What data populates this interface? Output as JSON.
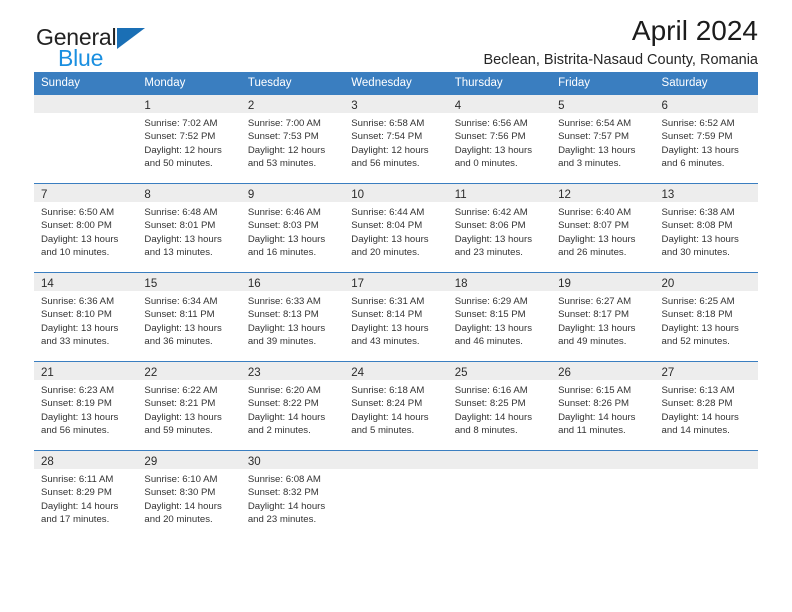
{
  "brand": {
    "name_part1": "General",
    "name_part2": "Blue",
    "triangle_color": "#1a6fb5",
    "blue_text_color": "#1a8fe0"
  },
  "header": {
    "title": "April 2024",
    "subtitle": "Beclean, Bistrita-Nasaud County, Romania"
  },
  "theme": {
    "header_blue": "#3a7ec0",
    "daynum_band": "#ededed",
    "text": "#333333"
  },
  "weekdays": [
    "Sunday",
    "Monday",
    "Tuesday",
    "Wednesday",
    "Thursday",
    "Friday",
    "Saturday"
  ],
  "weeks": [
    [
      {
        "day": ""
      },
      {
        "day": "1",
        "sunrise": "Sunrise: 7:02 AM",
        "sunset": "Sunset: 7:52 PM",
        "daylight_line1": "Daylight: 12 hours",
        "daylight_line2": "and 50 minutes."
      },
      {
        "day": "2",
        "sunrise": "Sunrise: 7:00 AM",
        "sunset": "Sunset: 7:53 PM",
        "daylight_line1": "Daylight: 12 hours",
        "daylight_line2": "and 53 minutes."
      },
      {
        "day": "3",
        "sunrise": "Sunrise: 6:58 AM",
        "sunset": "Sunset: 7:54 PM",
        "daylight_line1": "Daylight: 12 hours",
        "daylight_line2": "and 56 minutes."
      },
      {
        "day": "4",
        "sunrise": "Sunrise: 6:56 AM",
        "sunset": "Sunset: 7:56 PM",
        "daylight_line1": "Daylight: 13 hours",
        "daylight_line2": "and 0 minutes."
      },
      {
        "day": "5",
        "sunrise": "Sunrise: 6:54 AM",
        "sunset": "Sunset: 7:57 PM",
        "daylight_line1": "Daylight: 13 hours",
        "daylight_line2": "and 3 minutes."
      },
      {
        "day": "6",
        "sunrise": "Sunrise: 6:52 AM",
        "sunset": "Sunset: 7:59 PM",
        "daylight_line1": "Daylight: 13 hours",
        "daylight_line2": "and 6 minutes."
      }
    ],
    [
      {
        "day": "7",
        "sunrise": "Sunrise: 6:50 AM",
        "sunset": "Sunset: 8:00 PM",
        "daylight_line1": "Daylight: 13 hours",
        "daylight_line2": "and 10 minutes."
      },
      {
        "day": "8",
        "sunrise": "Sunrise: 6:48 AM",
        "sunset": "Sunset: 8:01 PM",
        "daylight_line1": "Daylight: 13 hours",
        "daylight_line2": "and 13 minutes."
      },
      {
        "day": "9",
        "sunrise": "Sunrise: 6:46 AM",
        "sunset": "Sunset: 8:03 PM",
        "daylight_line1": "Daylight: 13 hours",
        "daylight_line2": "and 16 minutes."
      },
      {
        "day": "10",
        "sunrise": "Sunrise: 6:44 AM",
        "sunset": "Sunset: 8:04 PM",
        "daylight_line1": "Daylight: 13 hours",
        "daylight_line2": "and 20 minutes."
      },
      {
        "day": "11",
        "sunrise": "Sunrise: 6:42 AM",
        "sunset": "Sunset: 8:06 PM",
        "daylight_line1": "Daylight: 13 hours",
        "daylight_line2": "and 23 minutes."
      },
      {
        "day": "12",
        "sunrise": "Sunrise: 6:40 AM",
        "sunset": "Sunset: 8:07 PM",
        "daylight_line1": "Daylight: 13 hours",
        "daylight_line2": "and 26 minutes."
      },
      {
        "day": "13",
        "sunrise": "Sunrise: 6:38 AM",
        "sunset": "Sunset: 8:08 PM",
        "daylight_line1": "Daylight: 13 hours",
        "daylight_line2": "and 30 minutes."
      }
    ],
    [
      {
        "day": "14",
        "sunrise": "Sunrise: 6:36 AM",
        "sunset": "Sunset: 8:10 PM",
        "daylight_line1": "Daylight: 13 hours",
        "daylight_line2": "and 33 minutes."
      },
      {
        "day": "15",
        "sunrise": "Sunrise: 6:34 AM",
        "sunset": "Sunset: 8:11 PM",
        "daylight_line1": "Daylight: 13 hours",
        "daylight_line2": "and 36 minutes."
      },
      {
        "day": "16",
        "sunrise": "Sunrise: 6:33 AM",
        "sunset": "Sunset: 8:13 PM",
        "daylight_line1": "Daylight: 13 hours",
        "daylight_line2": "and 39 minutes."
      },
      {
        "day": "17",
        "sunrise": "Sunrise: 6:31 AM",
        "sunset": "Sunset: 8:14 PM",
        "daylight_line1": "Daylight: 13 hours",
        "daylight_line2": "and 43 minutes."
      },
      {
        "day": "18",
        "sunrise": "Sunrise: 6:29 AM",
        "sunset": "Sunset: 8:15 PM",
        "daylight_line1": "Daylight: 13 hours",
        "daylight_line2": "and 46 minutes."
      },
      {
        "day": "19",
        "sunrise": "Sunrise: 6:27 AM",
        "sunset": "Sunset: 8:17 PM",
        "daylight_line1": "Daylight: 13 hours",
        "daylight_line2": "and 49 minutes."
      },
      {
        "day": "20",
        "sunrise": "Sunrise: 6:25 AM",
        "sunset": "Sunset: 8:18 PM",
        "daylight_line1": "Daylight: 13 hours",
        "daylight_line2": "and 52 minutes."
      }
    ],
    [
      {
        "day": "21",
        "sunrise": "Sunrise: 6:23 AM",
        "sunset": "Sunset: 8:19 PM",
        "daylight_line1": "Daylight: 13 hours",
        "daylight_line2": "and 56 minutes."
      },
      {
        "day": "22",
        "sunrise": "Sunrise: 6:22 AM",
        "sunset": "Sunset: 8:21 PM",
        "daylight_line1": "Daylight: 13 hours",
        "daylight_line2": "and 59 minutes."
      },
      {
        "day": "23",
        "sunrise": "Sunrise: 6:20 AM",
        "sunset": "Sunset: 8:22 PM",
        "daylight_line1": "Daylight: 14 hours",
        "daylight_line2": "and 2 minutes."
      },
      {
        "day": "24",
        "sunrise": "Sunrise: 6:18 AM",
        "sunset": "Sunset: 8:24 PM",
        "daylight_line1": "Daylight: 14 hours",
        "daylight_line2": "and 5 minutes."
      },
      {
        "day": "25",
        "sunrise": "Sunrise: 6:16 AM",
        "sunset": "Sunset: 8:25 PM",
        "daylight_line1": "Daylight: 14 hours",
        "daylight_line2": "and 8 minutes."
      },
      {
        "day": "26",
        "sunrise": "Sunrise: 6:15 AM",
        "sunset": "Sunset: 8:26 PM",
        "daylight_line1": "Daylight: 14 hours",
        "daylight_line2": "and 11 minutes."
      },
      {
        "day": "27",
        "sunrise": "Sunrise: 6:13 AM",
        "sunset": "Sunset: 8:28 PM",
        "daylight_line1": "Daylight: 14 hours",
        "daylight_line2": "and 14 minutes."
      }
    ],
    [
      {
        "day": "28",
        "sunrise": "Sunrise: 6:11 AM",
        "sunset": "Sunset: 8:29 PM",
        "daylight_line1": "Daylight: 14 hours",
        "daylight_line2": "and 17 minutes."
      },
      {
        "day": "29",
        "sunrise": "Sunrise: 6:10 AM",
        "sunset": "Sunset: 8:30 PM",
        "daylight_line1": "Daylight: 14 hours",
        "daylight_line2": "and 20 minutes."
      },
      {
        "day": "30",
        "sunrise": "Sunrise: 6:08 AM",
        "sunset": "Sunset: 8:32 PM",
        "daylight_line1": "Daylight: 14 hours",
        "daylight_line2": "and 23 minutes."
      },
      {
        "day": ""
      },
      {
        "day": ""
      },
      {
        "day": ""
      },
      {
        "day": ""
      }
    ]
  ]
}
